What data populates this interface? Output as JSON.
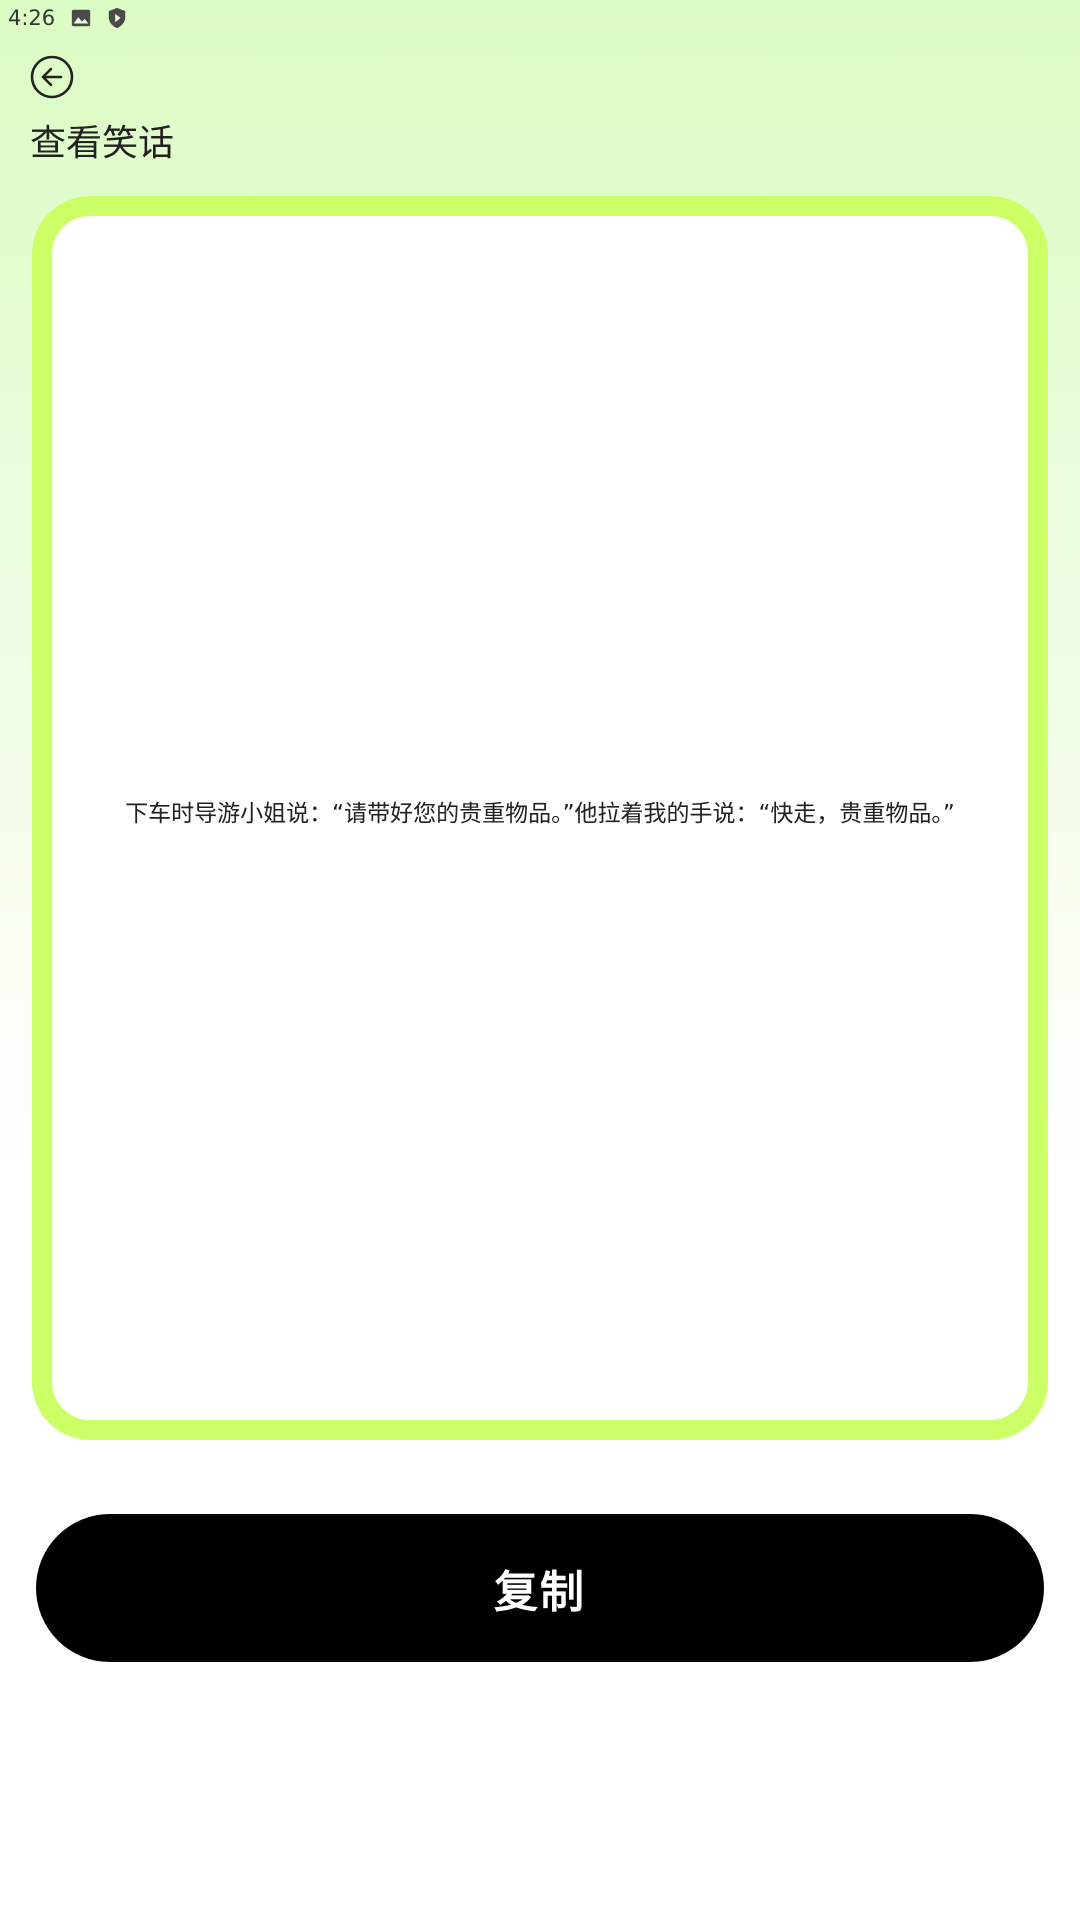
{
  "status_bar": {
    "time": "4:26",
    "icons": [
      "image-icon",
      "shield-play-icon"
    ]
  },
  "header": {
    "back_icon": "arrow-left-circle-icon",
    "title": "查看笑话"
  },
  "joke": {
    "text": "下车时导游小姐说：“请带好您的贵重物品。”他拉着我的手说：“快走，贵重物品。”"
  },
  "actions": {
    "copy_label": "复制"
  },
  "colors": {
    "card_border": "#ccff66",
    "button_bg": "#000000",
    "button_text": "#ffffff",
    "bg_top": "#dbfcc3"
  }
}
